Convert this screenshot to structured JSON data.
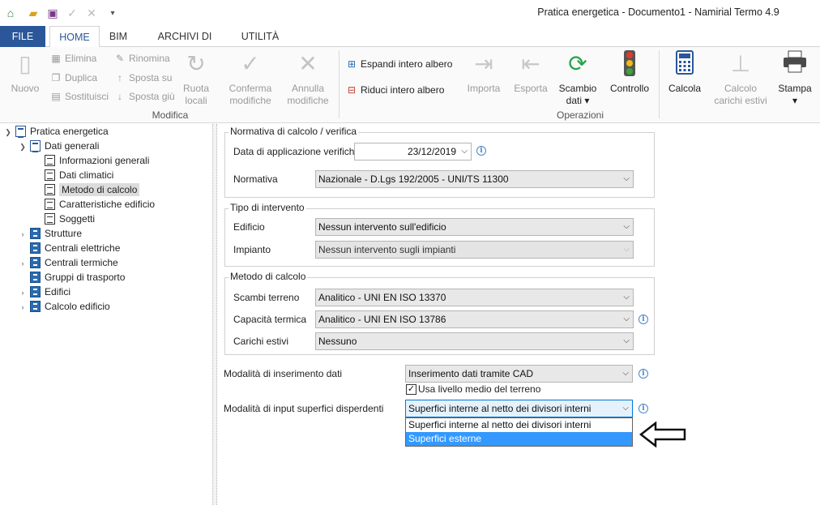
{
  "window": {
    "title": "Pratica energetica - Documento1 - Namirial Termo 4.9"
  },
  "quick_access": [
    {
      "name": "home-icon",
      "glyph": "⌂"
    },
    {
      "name": "open-folder-icon",
      "glyph": "▰"
    },
    {
      "name": "save-icon",
      "glyph": "▣"
    },
    {
      "name": "confirm-icon",
      "glyph": "✓"
    },
    {
      "name": "cancel-icon",
      "glyph": "✕"
    },
    {
      "name": "customize-icon",
      "glyph": "▾"
    }
  ],
  "tabs": {
    "file": "FILE",
    "home": "HOME",
    "bim": "BIM",
    "archivi": "ARCHIVI DI BASE",
    "utilita": "UTILITÀ"
  },
  "ribbon": {
    "nuovo": "Nuovo",
    "elimina": "Elimina",
    "duplica": "Duplica",
    "sostituisci": "Sostituisci",
    "rinomina": "Rinomina",
    "sposta_su": "Sposta su",
    "sposta_giu": "Sposta giù",
    "ruota_1": "Ruota",
    "ruota_2": "locali",
    "conferma_1": "Conferma",
    "conferma_2": "modifiche",
    "annulla_1": "Annulla",
    "annulla_2": "modifiche",
    "group_modifica": "Modifica",
    "espandi": "Espandi intero albero",
    "riduci": "Riduci intero albero",
    "importa": "Importa",
    "esporta": "Esporta",
    "scambio_1": "Scambio",
    "scambio_2": "dati ▾",
    "controllo": "Controllo",
    "group_operazioni": "Operazioni",
    "calcola": "Calcola",
    "calcolo_carichi_1": "Calcolo",
    "calcolo_carichi_2": "carichi estivi",
    "stampa": "Stampa",
    "stampa_arrow": "▾"
  },
  "tree": {
    "root": "Pratica energetica",
    "dati_generali": "Dati generali",
    "informazioni_generali": "Informazioni generali",
    "dati_climatici": "Dati climatici",
    "metodo_di_calcolo": "Metodo di calcolo",
    "caratteristiche_edificio": "Caratteristiche edificio",
    "soggetti": "Soggetti",
    "strutture": "Strutture",
    "centrali_elettriche": "Centrali elettriche",
    "centrali_termiche": "Centrali termiche",
    "gruppi_di_trasporto": "Gruppi di trasporto",
    "edifici": "Edifici",
    "calcolo_edificio": "Calcolo edificio"
  },
  "form": {
    "normativa_group": "Normativa di calcolo / verifica",
    "data_label": "Data di applicazione verifiche",
    "data_value": "23/12/2019",
    "normativa_label": "Normativa",
    "normativa_value": "Nazionale - D.Lgs 192/2005 - UNI/TS 11300",
    "tipo_group": "Tipo di intervento",
    "edificio_label": "Edificio",
    "edificio_value": "Nessun intervento sull'edificio",
    "impianto_label": "Impianto",
    "impianto_value": "Nessun intervento sugli impianti",
    "metodo_group": "Metodo di calcolo",
    "scambi_label": "Scambi terreno",
    "scambi_value": "Analitico - UNI EN ISO 13370",
    "capacita_label": "Capacità termica",
    "capacita_value": "Analitico - UNI EN ISO 13786",
    "carichi_label": "Carichi estivi",
    "carichi_value": "Nessuno",
    "modalita_inserimento_label": "Modalità di inserimento dati",
    "modalita_inserimento_value": "Inserimento dati tramite CAD",
    "usa_livello_label": "Usa livello medio del terreno",
    "usa_livello_checked": true,
    "modalita_input_label": "Modalità di input superfici disperdenti",
    "modalita_input_value": "Superfici interne al netto dei divisori interni",
    "dropdown_options": [
      "Superfici interne al netto dei divisori interni",
      "Superfici esterne"
    ],
    "dropdown_highlighted": "Superfici esterne"
  },
  "icons": {
    "info": "i",
    "dropdown_arrow": "⌵",
    "check": "✓"
  },
  "colors": {
    "file_tab": "#2b579a",
    "highlight": "#3399ff",
    "focus": "#0078d7"
  }
}
